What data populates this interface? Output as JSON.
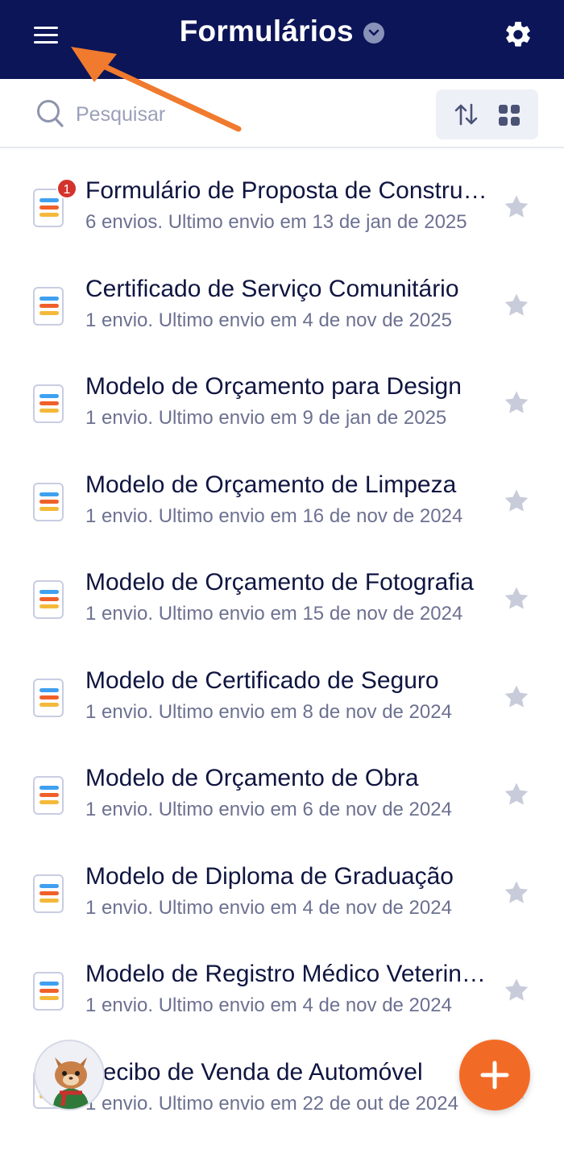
{
  "header": {
    "title": "Formulários",
    "menu_icon": "hamburger-menu-icon",
    "dropdown_icon": "chevron-down-icon",
    "settings_icon": "gear-icon",
    "background_color": "#0b1557"
  },
  "search": {
    "placeholder": "Pesquisar",
    "value": "",
    "sort_icon": "sort-arrows-icon",
    "view_icon": "grid-view-icon"
  },
  "forms": [
    {
      "title": "Formulário de Proposta de Construção",
      "subtitle": "6 envios. Ultimo envio em 13 de jan de 2025",
      "badge": "1"
    },
    {
      "title": "Certificado de Serviço Comunitário",
      "subtitle": "1 envio. Ultimo envio em 4 de nov de 2025",
      "badge": ""
    },
    {
      "title": "Modelo de Orçamento para Design",
      "subtitle": "1 envio. Ultimo envio em 9 de jan de 2025",
      "badge": ""
    },
    {
      "title": "Modelo de Orçamento de Limpeza",
      "subtitle": "1 envio. Ultimo envio em 16 de nov de 2024",
      "badge": ""
    },
    {
      "title": "Modelo de Orçamento de Fotografia",
      "subtitle": "1 envio. Ultimo envio em 15 de nov de 2024",
      "badge": ""
    },
    {
      "title": "Modelo de Certificado de Seguro",
      "subtitle": "1 envio. Ultimo envio em 8 de nov de 2024",
      "badge": ""
    },
    {
      "title": "Modelo de Orçamento de Obra",
      "subtitle": "1 envio. Ultimo envio em 6 de nov de 2024",
      "badge": ""
    },
    {
      "title": "Modelo de Diploma de Graduação",
      "subtitle": "1 envio. Ultimo envio em 4 de nov de 2024",
      "badge": ""
    },
    {
      "title": "Modelo de Registro Médico Veterinário",
      "subtitle": "1 envio. Ultimo envio em 4 de nov de 2024",
      "badge": ""
    },
    {
      "title": "Recibo de Venda de Automóvel",
      "subtitle": "1 envio. Ultimo envio em 22 de out de 2024",
      "badge": ""
    }
  ],
  "fab": {
    "icon": "plus-icon",
    "color": "#f26b26"
  },
  "avatar": {
    "icon": "cat-mascot-avatar-icon"
  },
  "annotation": {
    "icon": "orange-arrow-icon",
    "color": "#f07a2e"
  }
}
